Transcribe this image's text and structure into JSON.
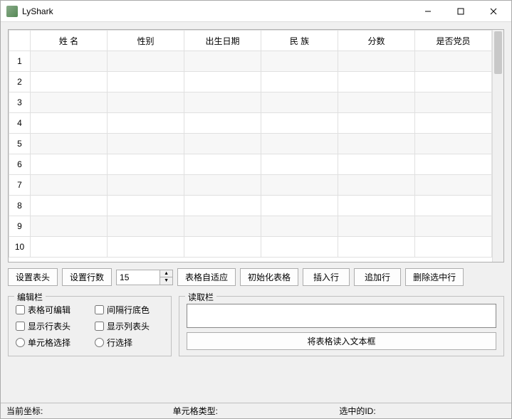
{
  "window": {
    "title": "LyShark"
  },
  "table": {
    "columns": [
      "姓 名",
      "性别",
      "出生日期",
      "民 族",
      "分数",
      "是否党员"
    ],
    "row_count": 10
  },
  "toolbar": {
    "set_header": "设置表头",
    "set_rows": "设置行数",
    "row_value": "15",
    "auto_fit": "表格自适应",
    "init_table": "初始化表格",
    "insert_row": "插入行",
    "append_row": "追加行",
    "delete_selected": "删除选中行"
  },
  "edit_group": {
    "title": "编辑栏",
    "editable": "表格可编辑",
    "alt_row_bg": "间隔行底色",
    "show_row_header": "显示行表头",
    "show_col_header": "显示列表头",
    "cell_select": "单元格选择",
    "row_select": "行选择"
  },
  "read_group": {
    "title": "读取栏",
    "read_btn": "将表格读入文本框"
  },
  "status": {
    "coord": "当前坐标:",
    "cell_type": "单元格类型:",
    "selected_id": "选中的ID:"
  }
}
